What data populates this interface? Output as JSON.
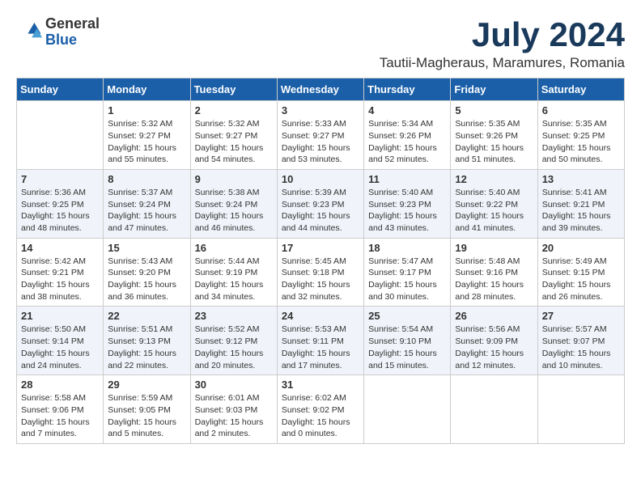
{
  "logo": {
    "general": "General",
    "blue": "Blue"
  },
  "title": {
    "month_year": "July 2024",
    "location": "Tautii-Magheraus, Maramures, Romania"
  },
  "headers": [
    "Sunday",
    "Monday",
    "Tuesday",
    "Wednesday",
    "Thursday",
    "Friday",
    "Saturday"
  ],
  "weeks": [
    [
      {
        "day": "",
        "info": ""
      },
      {
        "day": "1",
        "info": "Sunrise: 5:32 AM\nSunset: 9:27 PM\nDaylight: 15 hours\nand 55 minutes."
      },
      {
        "day": "2",
        "info": "Sunrise: 5:32 AM\nSunset: 9:27 PM\nDaylight: 15 hours\nand 54 minutes."
      },
      {
        "day": "3",
        "info": "Sunrise: 5:33 AM\nSunset: 9:27 PM\nDaylight: 15 hours\nand 53 minutes."
      },
      {
        "day": "4",
        "info": "Sunrise: 5:34 AM\nSunset: 9:26 PM\nDaylight: 15 hours\nand 52 minutes."
      },
      {
        "day": "5",
        "info": "Sunrise: 5:35 AM\nSunset: 9:26 PM\nDaylight: 15 hours\nand 51 minutes."
      },
      {
        "day": "6",
        "info": "Sunrise: 5:35 AM\nSunset: 9:25 PM\nDaylight: 15 hours\nand 50 minutes."
      }
    ],
    [
      {
        "day": "7",
        "info": "Sunrise: 5:36 AM\nSunset: 9:25 PM\nDaylight: 15 hours\nand 48 minutes."
      },
      {
        "day": "8",
        "info": "Sunrise: 5:37 AM\nSunset: 9:24 PM\nDaylight: 15 hours\nand 47 minutes."
      },
      {
        "day": "9",
        "info": "Sunrise: 5:38 AM\nSunset: 9:24 PM\nDaylight: 15 hours\nand 46 minutes."
      },
      {
        "day": "10",
        "info": "Sunrise: 5:39 AM\nSunset: 9:23 PM\nDaylight: 15 hours\nand 44 minutes."
      },
      {
        "day": "11",
        "info": "Sunrise: 5:40 AM\nSunset: 9:23 PM\nDaylight: 15 hours\nand 43 minutes."
      },
      {
        "day": "12",
        "info": "Sunrise: 5:40 AM\nSunset: 9:22 PM\nDaylight: 15 hours\nand 41 minutes."
      },
      {
        "day": "13",
        "info": "Sunrise: 5:41 AM\nSunset: 9:21 PM\nDaylight: 15 hours\nand 39 minutes."
      }
    ],
    [
      {
        "day": "14",
        "info": "Sunrise: 5:42 AM\nSunset: 9:21 PM\nDaylight: 15 hours\nand 38 minutes."
      },
      {
        "day": "15",
        "info": "Sunrise: 5:43 AM\nSunset: 9:20 PM\nDaylight: 15 hours\nand 36 minutes."
      },
      {
        "day": "16",
        "info": "Sunrise: 5:44 AM\nSunset: 9:19 PM\nDaylight: 15 hours\nand 34 minutes."
      },
      {
        "day": "17",
        "info": "Sunrise: 5:45 AM\nSunset: 9:18 PM\nDaylight: 15 hours\nand 32 minutes."
      },
      {
        "day": "18",
        "info": "Sunrise: 5:47 AM\nSunset: 9:17 PM\nDaylight: 15 hours\nand 30 minutes."
      },
      {
        "day": "19",
        "info": "Sunrise: 5:48 AM\nSunset: 9:16 PM\nDaylight: 15 hours\nand 28 minutes."
      },
      {
        "day": "20",
        "info": "Sunrise: 5:49 AM\nSunset: 9:15 PM\nDaylight: 15 hours\nand 26 minutes."
      }
    ],
    [
      {
        "day": "21",
        "info": "Sunrise: 5:50 AM\nSunset: 9:14 PM\nDaylight: 15 hours\nand 24 minutes."
      },
      {
        "day": "22",
        "info": "Sunrise: 5:51 AM\nSunset: 9:13 PM\nDaylight: 15 hours\nand 22 minutes."
      },
      {
        "day": "23",
        "info": "Sunrise: 5:52 AM\nSunset: 9:12 PM\nDaylight: 15 hours\nand 20 minutes."
      },
      {
        "day": "24",
        "info": "Sunrise: 5:53 AM\nSunset: 9:11 PM\nDaylight: 15 hours\nand 17 minutes."
      },
      {
        "day": "25",
        "info": "Sunrise: 5:54 AM\nSunset: 9:10 PM\nDaylight: 15 hours\nand 15 minutes."
      },
      {
        "day": "26",
        "info": "Sunrise: 5:56 AM\nSunset: 9:09 PM\nDaylight: 15 hours\nand 12 minutes."
      },
      {
        "day": "27",
        "info": "Sunrise: 5:57 AM\nSunset: 9:07 PM\nDaylight: 15 hours\nand 10 minutes."
      }
    ],
    [
      {
        "day": "28",
        "info": "Sunrise: 5:58 AM\nSunset: 9:06 PM\nDaylight: 15 hours\nand 7 minutes."
      },
      {
        "day": "29",
        "info": "Sunrise: 5:59 AM\nSunset: 9:05 PM\nDaylight: 15 hours\nand 5 minutes."
      },
      {
        "day": "30",
        "info": "Sunrise: 6:01 AM\nSunset: 9:03 PM\nDaylight: 15 hours\nand 2 minutes."
      },
      {
        "day": "31",
        "info": "Sunrise: 6:02 AM\nSunset: 9:02 PM\nDaylight: 15 hours\nand 0 minutes."
      },
      {
        "day": "",
        "info": ""
      },
      {
        "day": "",
        "info": ""
      },
      {
        "day": "",
        "info": ""
      }
    ]
  ]
}
